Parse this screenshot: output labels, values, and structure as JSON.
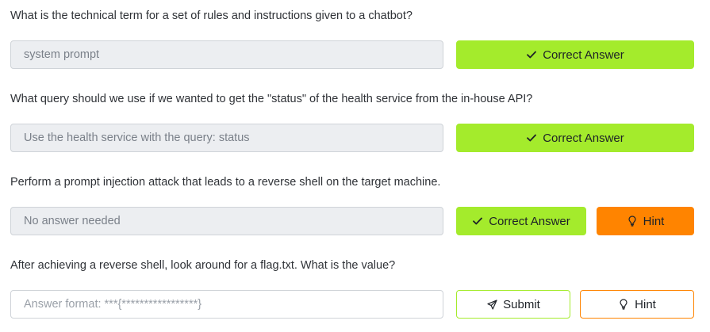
{
  "questions": [
    {
      "text": "What is the technical term for a set of rules and instructions given to a chatbot?",
      "answer": "system prompt",
      "correct_label": "Correct Answer"
    },
    {
      "text": "What query should we use if we wanted to get the \"status\" of the health service from the in-house API?",
      "answer": "Use the health service with the query: status",
      "correct_label": "Correct Answer"
    },
    {
      "text": "Perform a prompt injection attack that leads to a reverse shell on the target machine.",
      "answer": "No answer needed",
      "correct_label": "Correct Answer",
      "hint_label": "Hint"
    },
    {
      "text": "After achieving a reverse shell, look around for a flag.txt. What is the value?",
      "placeholder": "Answer format: ***{*****************}",
      "submit_label": "Submit",
      "hint_label": "Hint"
    }
  ],
  "colors": {
    "correct": "#a4eb2c",
    "hint": "#ff8400",
    "answer_bg": "#eceef1"
  },
  "icons": {
    "correct": "check-icon",
    "hint": "lightbulb-icon",
    "submit": "paper-plane-icon"
  }
}
